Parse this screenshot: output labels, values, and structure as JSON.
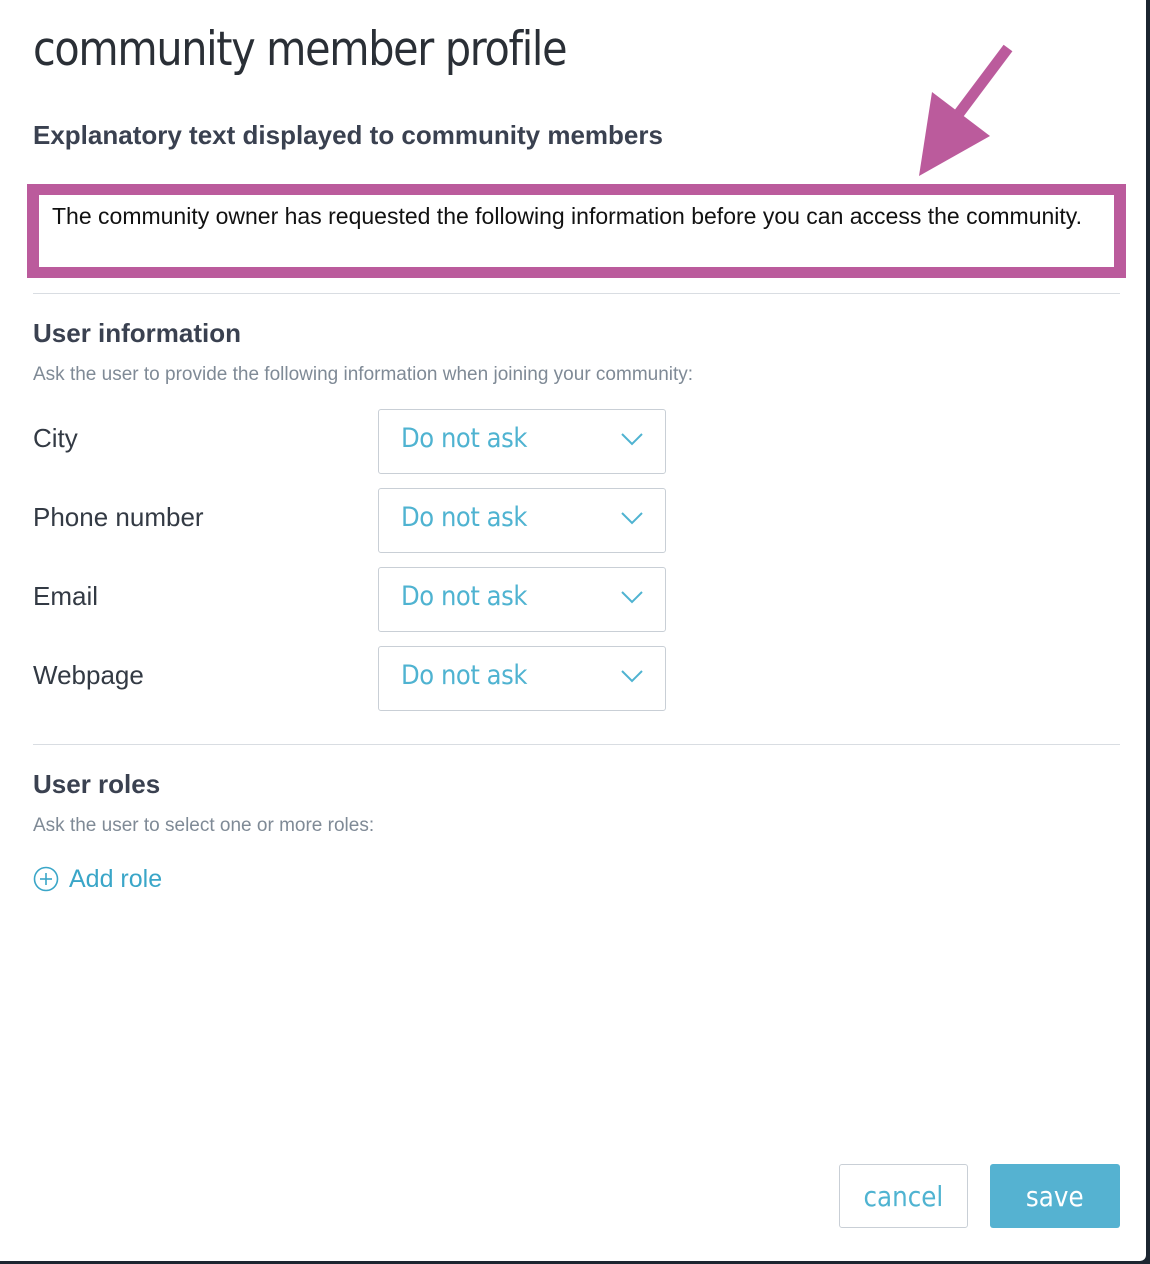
{
  "modal": {
    "title": "community member profile"
  },
  "explanatory": {
    "heading": "Explanatory text displayed to community members",
    "text": "The community owner has requested the following information before you can access the community."
  },
  "user_information": {
    "heading": "User information",
    "hint": "Ask the user to provide the following information when joining your community:",
    "fields": [
      {
        "label": "City",
        "value": "Do not ask"
      },
      {
        "label": "Phone number",
        "value": "Do not ask"
      },
      {
        "label": "Email",
        "value": "Do not ask"
      },
      {
        "label": "Webpage",
        "value": "Do not ask"
      }
    ]
  },
  "user_roles": {
    "heading": "User roles",
    "hint": "Ask the user to select one or more roles:",
    "add_label": "Add role"
  },
  "buttons": {
    "cancel": "cancel",
    "save": "save"
  },
  "colors": {
    "accent": "#4fb3d1",
    "save_button": "#55b2d1",
    "highlight": "#bb5b9c"
  },
  "icons": {
    "annotation": "arrow-icon",
    "dropdown": "chevron-down-icon",
    "add": "plus-circle-icon"
  }
}
